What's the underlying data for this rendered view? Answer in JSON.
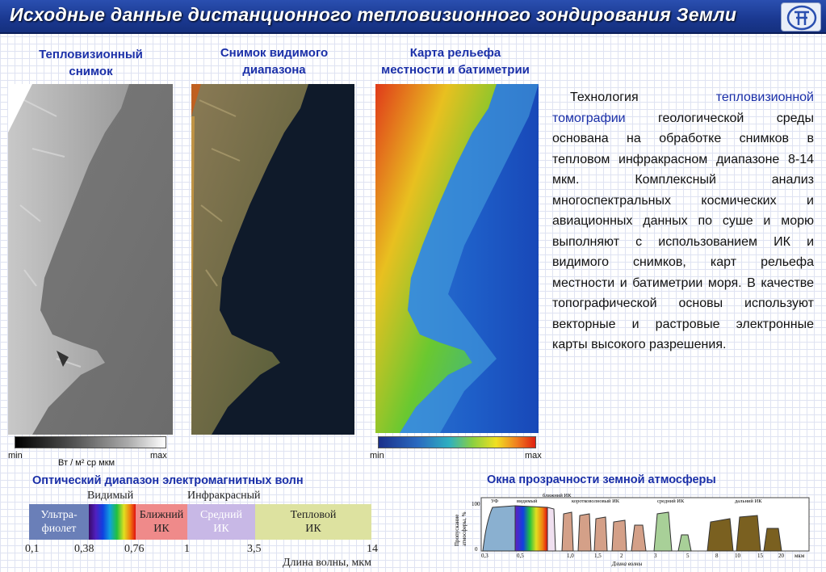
{
  "header": {
    "title": "Исходные данные дистанционного тепловизионного зондирования Земли",
    "logo_icon": "institute-logo-icon"
  },
  "panels": {
    "thermal": {
      "caption_line1": "Тепловизионный",
      "caption_line2": "снимок"
    },
    "visible": {
      "caption_line1": "Снимок видимого",
      "caption_line2": "диапазона"
    },
    "relief": {
      "caption_line1": "Карта рельефа",
      "caption_line2": "местности и батиметрии"
    }
  },
  "scales": {
    "thermal": {
      "min": "min",
      "max": "max",
      "unit": "Вт / м² ср мкм"
    },
    "relief": {
      "min": "min",
      "max": "max"
    }
  },
  "description": {
    "part1": "Технология ",
    "highlight": "тепловизионной томографии",
    "part2": " геологической среды основана на обработке снимков в тепловом инфракрасном диапазоне 8-14 мкм. Комплексный анализ многоспектральных космических и авиационных данных по суше и морю выполняют с использованием ИК и видимого снимков, карт рельефа местности и батиметрии моря. В качестве топографической основы используют векторные и растровые электронные карты высокого разрешения."
  },
  "spectrum": {
    "title": "Оптический диапазон электромагнитных волн",
    "top_labels": {
      "visible": "Видимый",
      "infrared": "Инфракрасный"
    },
    "segments": {
      "uv_line1": "Ультра-",
      "uv_line2": "фиолет",
      "near_line1": "Ближний",
      "near_line2": "ИК",
      "mid_line1": "Средний",
      "mid_line2": "ИК",
      "thermal_line1": "Тепловой",
      "thermal_line2": "ИК"
    },
    "ticks": [
      "0,1",
      "0,38",
      "0,76",
      "1",
      "3,5",
      "14"
    ],
    "axis_label": "Длина волны, мкм",
    "colors": {
      "uv": "#6a7fb8",
      "near": "#ef8a8a",
      "mid": "#c8b8e6",
      "thermal": "#dde2a0"
    }
  },
  "atmosphere": {
    "title": "Окна прозрачности земной атмосферы",
    "y_label_line1": "Пропускание",
    "y_label_line2": "атмосферы, %",
    "y_max": "100",
    "y_zero": "0",
    "bands": [
      "УФ",
      "видимый",
      "ближний ИК",
      "коротковолновый ИК",
      "средний ИК",
      "дальний ИК"
    ],
    "ticks": [
      "0,3",
      "0,5",
      "1,0",
      "1,5",
      "2",
      "3",
      "5",
      "8",
      "10",
      "15",
      "20"
    ],
    "tick_unit": "мкм",
    "x_label": "Длина волны"
  }
}
